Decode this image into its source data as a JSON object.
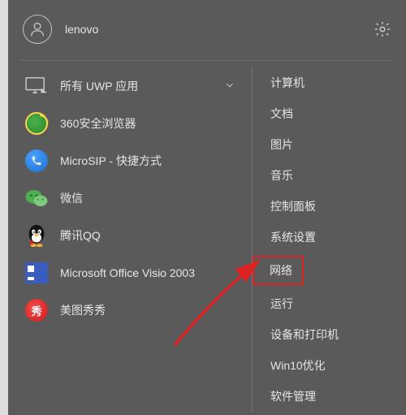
{
  "header": {
    "username": "lenovo"
  },
  "left": {
    "allApps": {
      "label": "所有 UWP 应用"
    },
    "apps": [
      {
        "label": "360安全浏览器"
      },
      {
        "label": "MicroSIP - 快捷方式"
      },
      {
        "label": "微信"
      },
      {
        "label": "腾讯QQ"
      },
      {
        "label": "Microsoft Office Visio 2003"
      },
      {
        "label": "美图秀秀"
      }
    ]
  },
  "right": {
    "items": [
      {
        "label": "计算机"
      },
      {
        "label": "文档"
      },
      {
        "label": "图片"
      },
      {
        "label": "音乐"
      },
      {
        "label": "控制面板"
      },
      {
        "label": "系统设置"
      },
      {
        "label": "网络",
        "highlighted": true
      },
      {
        "label": "运行"
      },
      {
        "label": "设备和打印机"
      },
      {
        "label": "Win10优化"
      },
      {
        "label": "软件管理"
      }
    ]
  },
  "meituGlyph": "秀"
}
